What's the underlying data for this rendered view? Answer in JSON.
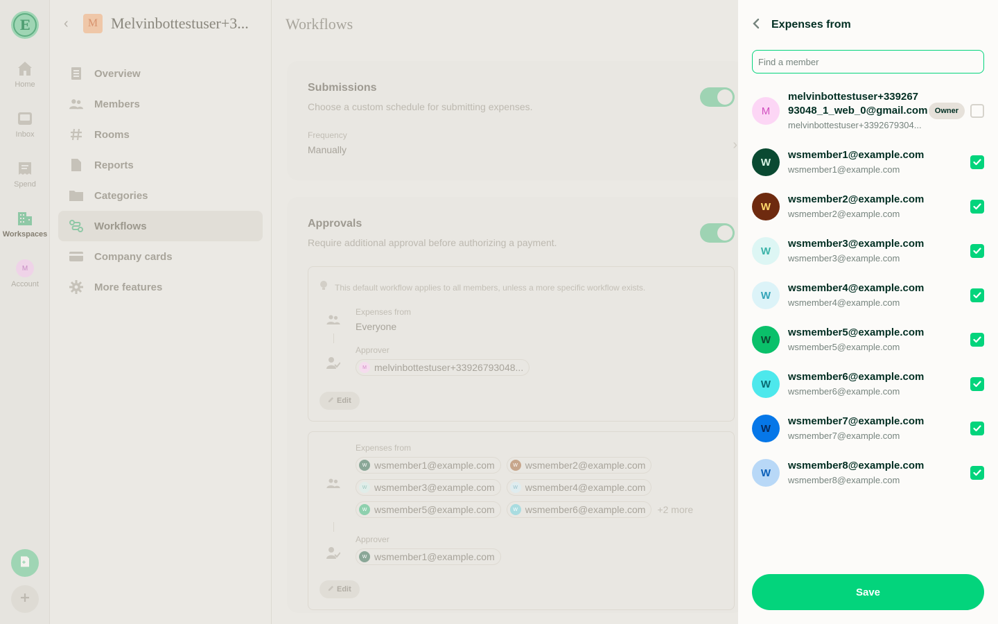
{
  "rail": {
    "logo_letter": "E",
    "items": [
      {
        "label": "Home",
        "icon": "home-icon"
      },
      {
        "label": "Inbox",
        "icon": "inbox-icon"
      },
      {
        "label": "Spend",
        "icon": "receipt-icon"
      },
      {
        "label": "Workspaces",
        "icon": "building-icon"
      },
      {
        "label": "Account",
        "icon": "avatar"
      }
    ],
    "account_initial": "M"
  },
  "sidebar": {
    "workspace_initial": "M",
    "workspace_name": "Melvinbottestuser+3...",
    "menu": [
      {
        "label": "Overview"
      },
      {
        "label": "Members"
      },
      {
        "label": "Rooms"
      },
      {
        "label": "Reports"
      },
      {
        "label": "Categories"
      },
      {
        "label": "Workflows"
      },
      {
        "label": "Company cards"
      },
      {
        "label": "More features"
      }
    ]
  },
  "main": {
    "title": "Workflows",
    "submissions": {
      "title": "Submissions",
      "subtitle": "Choose a custom schedule for submitting expenses.",
      "frequency_label": "Frequency",
      "frequency_value": "Manually"
    },
    "approvals": {
      "title": "Approvals",
      "subtitle": "Require additional approval before authorizing a payment.",
      "default_note": "This default workflow applies to all members, unless a more specific workflow exists.",
      "expenses_from_label": "Expenses from",
      "expenses_from_value": "Everyone",
      "approver_label": "Approver",
      "approver_value": "melvinbottestuser+33926793048...",
      "edit_label": "Edit"
    },
    "workflow2": {
      "expenses_from_label": "Expenses from",
      "chips": [
        "wsmember1@example.com",
        "wsmember2@example.com",
        "wsmember3@example.com",
        "wsmember4@example.com",
        "wsmember5@example.com",
        "wsmember6@example.com"
      ],
      "more": "+2 more",
      "approver_label": "Approver",
      "approver_value": "wsmember1@example.com",
      "edit_label": "Edit"
    }
  },
  "panel": {
    "title": "Expenses from",
    "search_placeholder": "Find a member",
    "owner_badge": "Owner",
    "members": [
      {
        "initial": "M",
        "name": "melvinbottestuser+339267\n93048_1_web_0@gmail.com",
        "email": "melvinbottestuser+3392679304...",
        "selected": false,
        "avatar_bg": "#fcd6f5",
        "avatar_fg": "#d04fbf",
        "owner": true
      },
      {
        "initial": "W",
        "name": "wsmember1@example.com",
        "email": "wsmember1@example.com",
        "selected": true,
        "avatar_bg": "#0a4a32",
        "avatar_fg": "#d8f5e6"
      },
      {
        "initial": "W",
        "name": "wsmember2@example.com",
        "email": "wsmember2@example.com",
        "selected": true,
        "avatar_bg": "#6e2a0f",
        "avatar_fg": "#ffd86b"
      },
      {
        "initial": "W",
        "name": "wsmember3@example.com",
        "email": "wsmember3@example.com",
        "selected": true,
        "avatar_bg": "#ddf6f4",
        "avatar_fg": "#3bb3a8"
      },
      {
        "initial": "W",
        "name": "wsmember4@example.com",
        "email": "wsmember4@example.com",
        "selected": true,
        "avatar_bg": "#dcf3f8",
        "avatar_fg": "#34a4b8"
      },
      {
        "initial": "W",
        "name": "wsmember5@example.com",
        "email": "wsmember5@example.com",
        "selected": true,
        "avatar_bg": "#0ac06a",
        "avatar_fg": "#0a4a32"
      },
      {
        "initial": "W",
        "name": "wsmember6@example.com",
        "email": "wsmember6@example.com",
        "selected": true,
        "avatar_bg": "#4de8ec",
        "avatar_fg": "#0a6b72"
      },
      {
        "initial": "W",
        "name": "wsmember7@example.com",
        "email": "wsmember7@example.com",
        "selected": true,
        "avatar_bg": "#0677e8",
        "avatar_fg": "#062a5e"
      },
      {
        "initial": "W",
        "name": "wsmember8@example.com",
        "email": "wsmember8@example.com",
        "selected": true,
        "avatar_bg": "#b8d8f7",
        "avatar_fg": "#0a5fb8"
      }
    ],
    "save_label": "Save"
  },
  "colors": {
    "accent": "#03d47c",
    "text": "#002e22",
    "muted": "#76847e"
  }
}
